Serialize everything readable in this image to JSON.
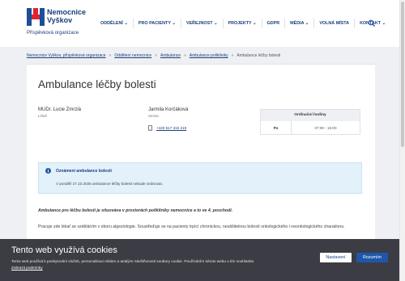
{
  "brand": {
    "name_line1": "Nemocnice",
    "name_line2": "Vyškov",
    "tagline": "Příspěvková organizace",
    "colors": {
      "blue": "#1a4f9c",
      "red": "#e2232e"
    }
  },
  "nav": {
    "items": [
      {
        "label": "ODDĚLENÍ",
        "caret": "⌄"
      },
      {
        "label": "PRO PACIENTY",
        "caret": "⌄"
      },
      {
        "label": "VEŘEJNOST",
        "caret": "⌄"
      },
      {
        "label": "PROJEKTY",
        "caret": "⌄"
      },
      {
        "label": "GDPR",
        "caret": ""
      },
      {
        "label": "MÉDIA",
        "caret": "⌄"
      },
      {
        "label": "VOLNÁ MÍSTA",
        "caret": ""
      },
      {
        "label": "KONTAKT",
        "caret": "⌄"
      }
    ],
    "search_icon": "search-icon"
  },
  "breadcrumb": {
    "items": [
      "Nemocnice Vyškov, příspěvková organizace",
      "Oddělení nemocnice",
      "Ambulance",
      "Ambulance polikliniky"
    ],
    "separator": "»",
    "current": "Ambulance léčby bolesti"
  },
  "page": {
    "title": "Ambulance léčby bolesti",
    "staff": [
      {
        "name": "MUDr. Lucie Zmrzlá",
        "role": "Lékař"
      },
      {
        "name": "Jarmila Korčáková",
        "role": "Sestra"
      }
    ],
    "phone": "+420 517 315 219",
    "hours": {
      "header": "Ordinační hodiny",
      "rows": [
        {
          "day": "Po",
          "time": "07:00 - 15:00"
        }
      ]
    },
    "alert": {
      "title": "Oznámení ambulance bolesti",
      "body": "V pondělí 27.10.2025 ambulance léčby bolesti nebude ordinovat."
    },
    "note": "Ambulance pro léčbu bolesti je situována v prostorách polikliniky nemocnice a to ve 4. poschodí.",
    "paragraph": "Pracuje zde lékař se vzděláním v oboru algeziologie. Soustřeďuje se na pacienty trpící chronickou, neutišitelnou bolestí onkologického i neonkologického charakteru."
  },
  "cookie": {
    "title": "Tento web využívá cookies",
    "body": "Tento web používá k poskytování služeb, personalizaci reklam a analýze návštěvnosti soubory cookie. Používáním tohoto webu s tím souhlasíte.",
    "link": "Zobrazit podmínky",
    "settings_label": "Nastavení",
    "accept_label": "Rozumím"
  }
}
